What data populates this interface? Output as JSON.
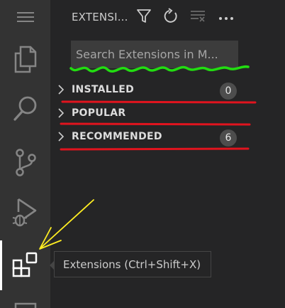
{
  "activity_bar": {
    "items": [
      {
        "name": "menu",
        "icon": "hamburger-menu-icon"
      },
      {
        "name": "explorer",
        "icon": "files-icon"
      },
      {
        "name": "search",
        "icon": "search-icon"
      },
      {
        "name": "source-control",
        "icon": "source-control-icon"
      },
      {
        "name": "run-debug",
        "icon": "run-debug-icon"
      },
      {
        "name": "extensions",
        "icon": "extensions-icon",
        "active": true
      }
    ],
    "colors": {
      "background": "#333333",
      "icon": "#858585",
      "active_icon": "#ffffff"
    }
  },
  "sidebar": {
    "title": "EXTENSI...",
    "actions": [
      {
        "name": "filter",
        "icon": "filter-icon"
      },
      {
        "name": "refresh",
        "icon": "refresh-icon"
      },
      {
        "name": "clear",
        "icon": "clear-all-icon"
      },
      {
        "name": "more",
        "icon": "ellipsis-icon"
      }
    ],
    "search": {
      "placeholder": "Search Extensions in M...",
      "value": ""
    },
    "sections": [
      {
        "label": "INSTALLED",
        "badge": "0"
      },
      {
        "label": "POPULAR",
        "badge": ""
      },
      {
        "label": "RECOMMENDED",
        "badge": "6"
      }
    ]
  },
  "tooltip": {
    "text": "Extensions (Ctrl+Shift+X)"
  },
  "annotations": {
    "underline_colors": {
      "green": "#22dd11",
      "red": "#e0141e"
    },
    "arrow_color": "#ffee22"
  }
}
